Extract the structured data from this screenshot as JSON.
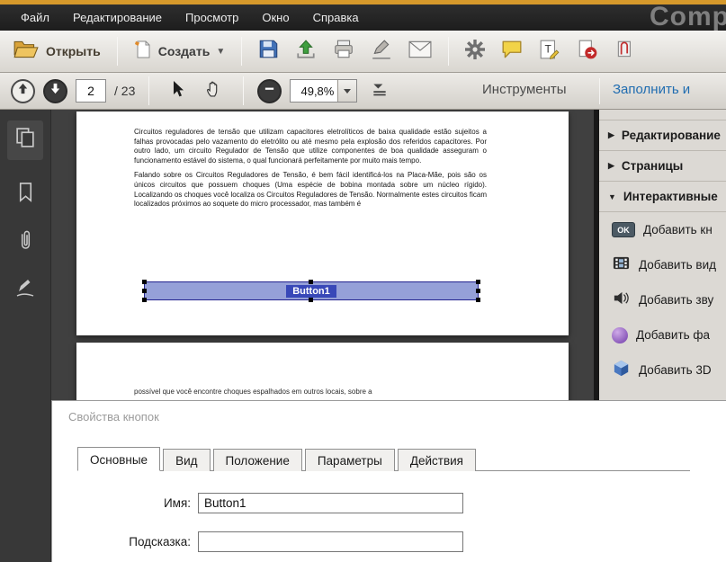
{
  "chrome": {
    "window_title_fragment": "Comp",
    "menu_items": [
      "Файл",
      "Редактирование",
      "Просмотр",
      "Окно",
      "Справка"
    ]
  },
  "toolbar": {
    "open_label": "Открыть",
    "create_label": "Создать",
    "icon_names": [
      "folder-open-icon",
      "create-document-icon",
      "save-icon",
      "upload-icon",
      "print-icon",
      "sign-icon",
      "mail-icon",
      "gear-icon",
      "comment-icon",
      "text-note-icon",
      "export-pdf-icon",
      "attach-icon"
    ]
  },
  "nav": {
    "page_current": "2",
    "page_total": "/ 23",
    "zoom_level": "49,8%",
    "tools_label": "Инструменты",
    "fill_sign_label": "Заполнить и"
  },
  "sidebar": {
    "icon_names": [
      "page-thumbnails-icon",
      "bookmark-icon",
      "paperclip-icon",
      "signature-icon"
    ]
  },
  "document": {
    "para1": "Circuitos reguladores de tensão que utilizam capacitores eletrolíticos de baixa qualidade estão sujeitos a falhas provocadas pelo vazamento do eletrólito ou até mesmo pela explosão dos referidos capacitores. Por outro lado, um circuito Regulador de Tensão que utilize componentes de boa qualidade asseguram o funcionamento estável do sistema, o qual funcionará perfeitamente por muito mais tempo.",
    "para2": "Falando sobre os Circuitos Reguladores de Tensão, é bem fácil identificá-los na Placa-Mãe, pois são os únicos circuitos que possuem choques (Uma espécie de bobina montada sobre um núcleo rígido). Localizando os choques você localiza os Circuitos Reguladores de Tensão. Normalmente estes circuitos ficam localizados próximos ao soquete do micro processador, mas também é",
    "page2_line": "possível que você encontre choques espalhados em outros locais, sobre a",
    "form_button_label": "Button1"
  },
  "right_panel": {
    "sections": [
      {
        "label": "Редактирование",
        "chevron": "▶"
      },
      {
        "label": "Страницы",
        "chevron": "▶"
      },
      {
        "label": "Интерактивные",
        "chevron": "▼"
      }
    ],
    "items": [
      {
        "icon": "ok-button-icon",
        "badge": "OK",
        "label": "Добавить кн"
      },
      {
        "icon": "video-icon",
        "label": "Добавить вид"
      },
      {
        "icon": "sound-icon",
        "label": "Добавить зву"
      },
      {
        "icon": "file-attachment-icon",
        "label": "Добавить фа"
      },
      {
        "icon": "3d-object-icon",
        "label": "Добавить 3D"
      }
    ]
  },
  "dialog": {
    "title": "Свойства кнопок",
    "tabs": [
      "Основные",
      "Вид",
      "Положение",
      "Параметры",
      "Действия"
    ],
    "name_label": "Имя:",
    "name_value": "Button1",
    "tooltip_label": "Подсказка:",
    "tooltip_value": ""
  },
  "colors": {
    "accent_orange": "#d6992b",
    "link_blue": "#1f6cb0",
    "selection_blue": "#95a0d8"
  }
}
